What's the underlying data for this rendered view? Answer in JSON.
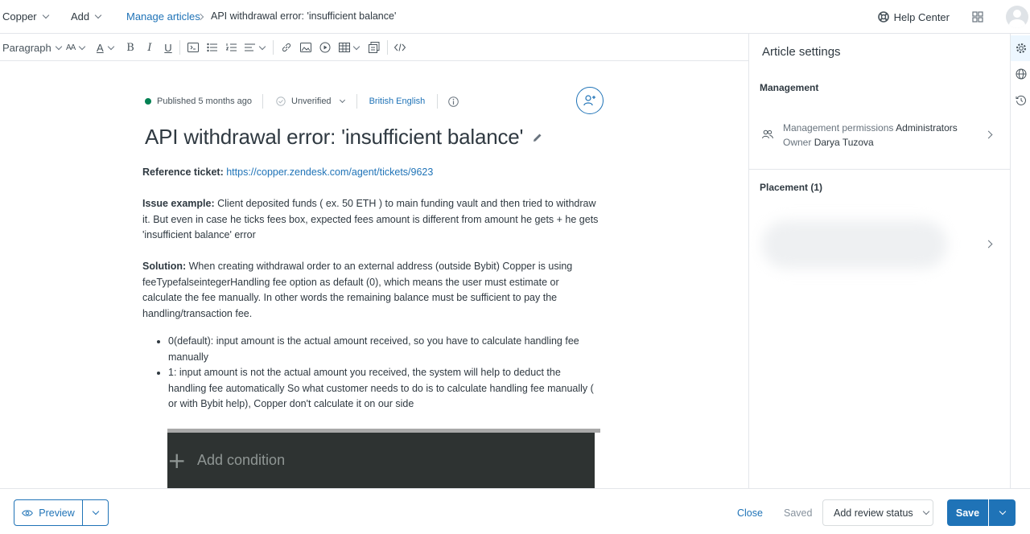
{
  "topbar": {
    "brand": "Copper",
    "add": "Add",
    "breadcrumb_link": "Manage articles",
    "breadcrumb_current": "API withdrawal error: 'insufficient balance'",
    "help_center": "Help Center"
  },
  "toolbar": {
    "paragraph": "Paragraph",
    "font_size": "AA",
    "text_color": "A",
    "bold": "B",
    "italic": "I",
    "underline": "U"
  },
  "meta": {
    "published": "Published 5 months ago",
    "verification": "Unverified",
    "language": "British English"
  },
  "article": {
    "title": "API withdrawal error: 'insufficient balance'",
    "ref_label": "Reference ticket:",
    "ref_link": "https://copper.zendesk.com/agent/tickets/9623",
    "issue_label": "Issue example:",
    "issue_text": " Client deposited funds ( ex. 50 ETH ) to main funding vault and then tried to withdraw it. But even in case he ticks fees box, expected fees amount is different from amount he gets + he gets 'insufficient balance' error",
    "solution_label": "Solution:",
    "solution_text": " When creating withdrawal order to an external address (outside Bybit) Copper is using feeTypefalseintegerHandling fee option as default (0), which means the user must estimate or calculate the fee manually. In other words the remaining balance must be sufficient to pay the handling/transaction fee.",
    "bullets": [
      "0(default): input amount is the actual amount received, so you have to calculate handling fee manually",
      "1: input amount is not the actual amount you received, the system will help to deduct the handling fee automatically So what customer needs to do is to calculate handling fee manually ( or with Bybit help), Copper don't calculate it on our side"
    ],
    "image_text": "Add condition",
    "image_plus": "+"
  },
  "panel": {
    "title": "Article settings",
    "management_heading": "Management",
    "permissions_label": "Management permissions",
    "permissions_value": "Administrators",
    "owner_label": "Owner",
    "owner_value": "Darya Tuzova",
    "placement_heading": "Placement (1)"
  },
  "bottombar": {
    "preview": "Preview",
    "close": "Close",
    "saved": "Saved",
    "review_status": "Add review status",
    "save": "Save"
  },
  "colors": {
    "accent": "#1f73b7",
    "published_dot": "#038153",
    "border": "#e3e6ea"
  }
}
